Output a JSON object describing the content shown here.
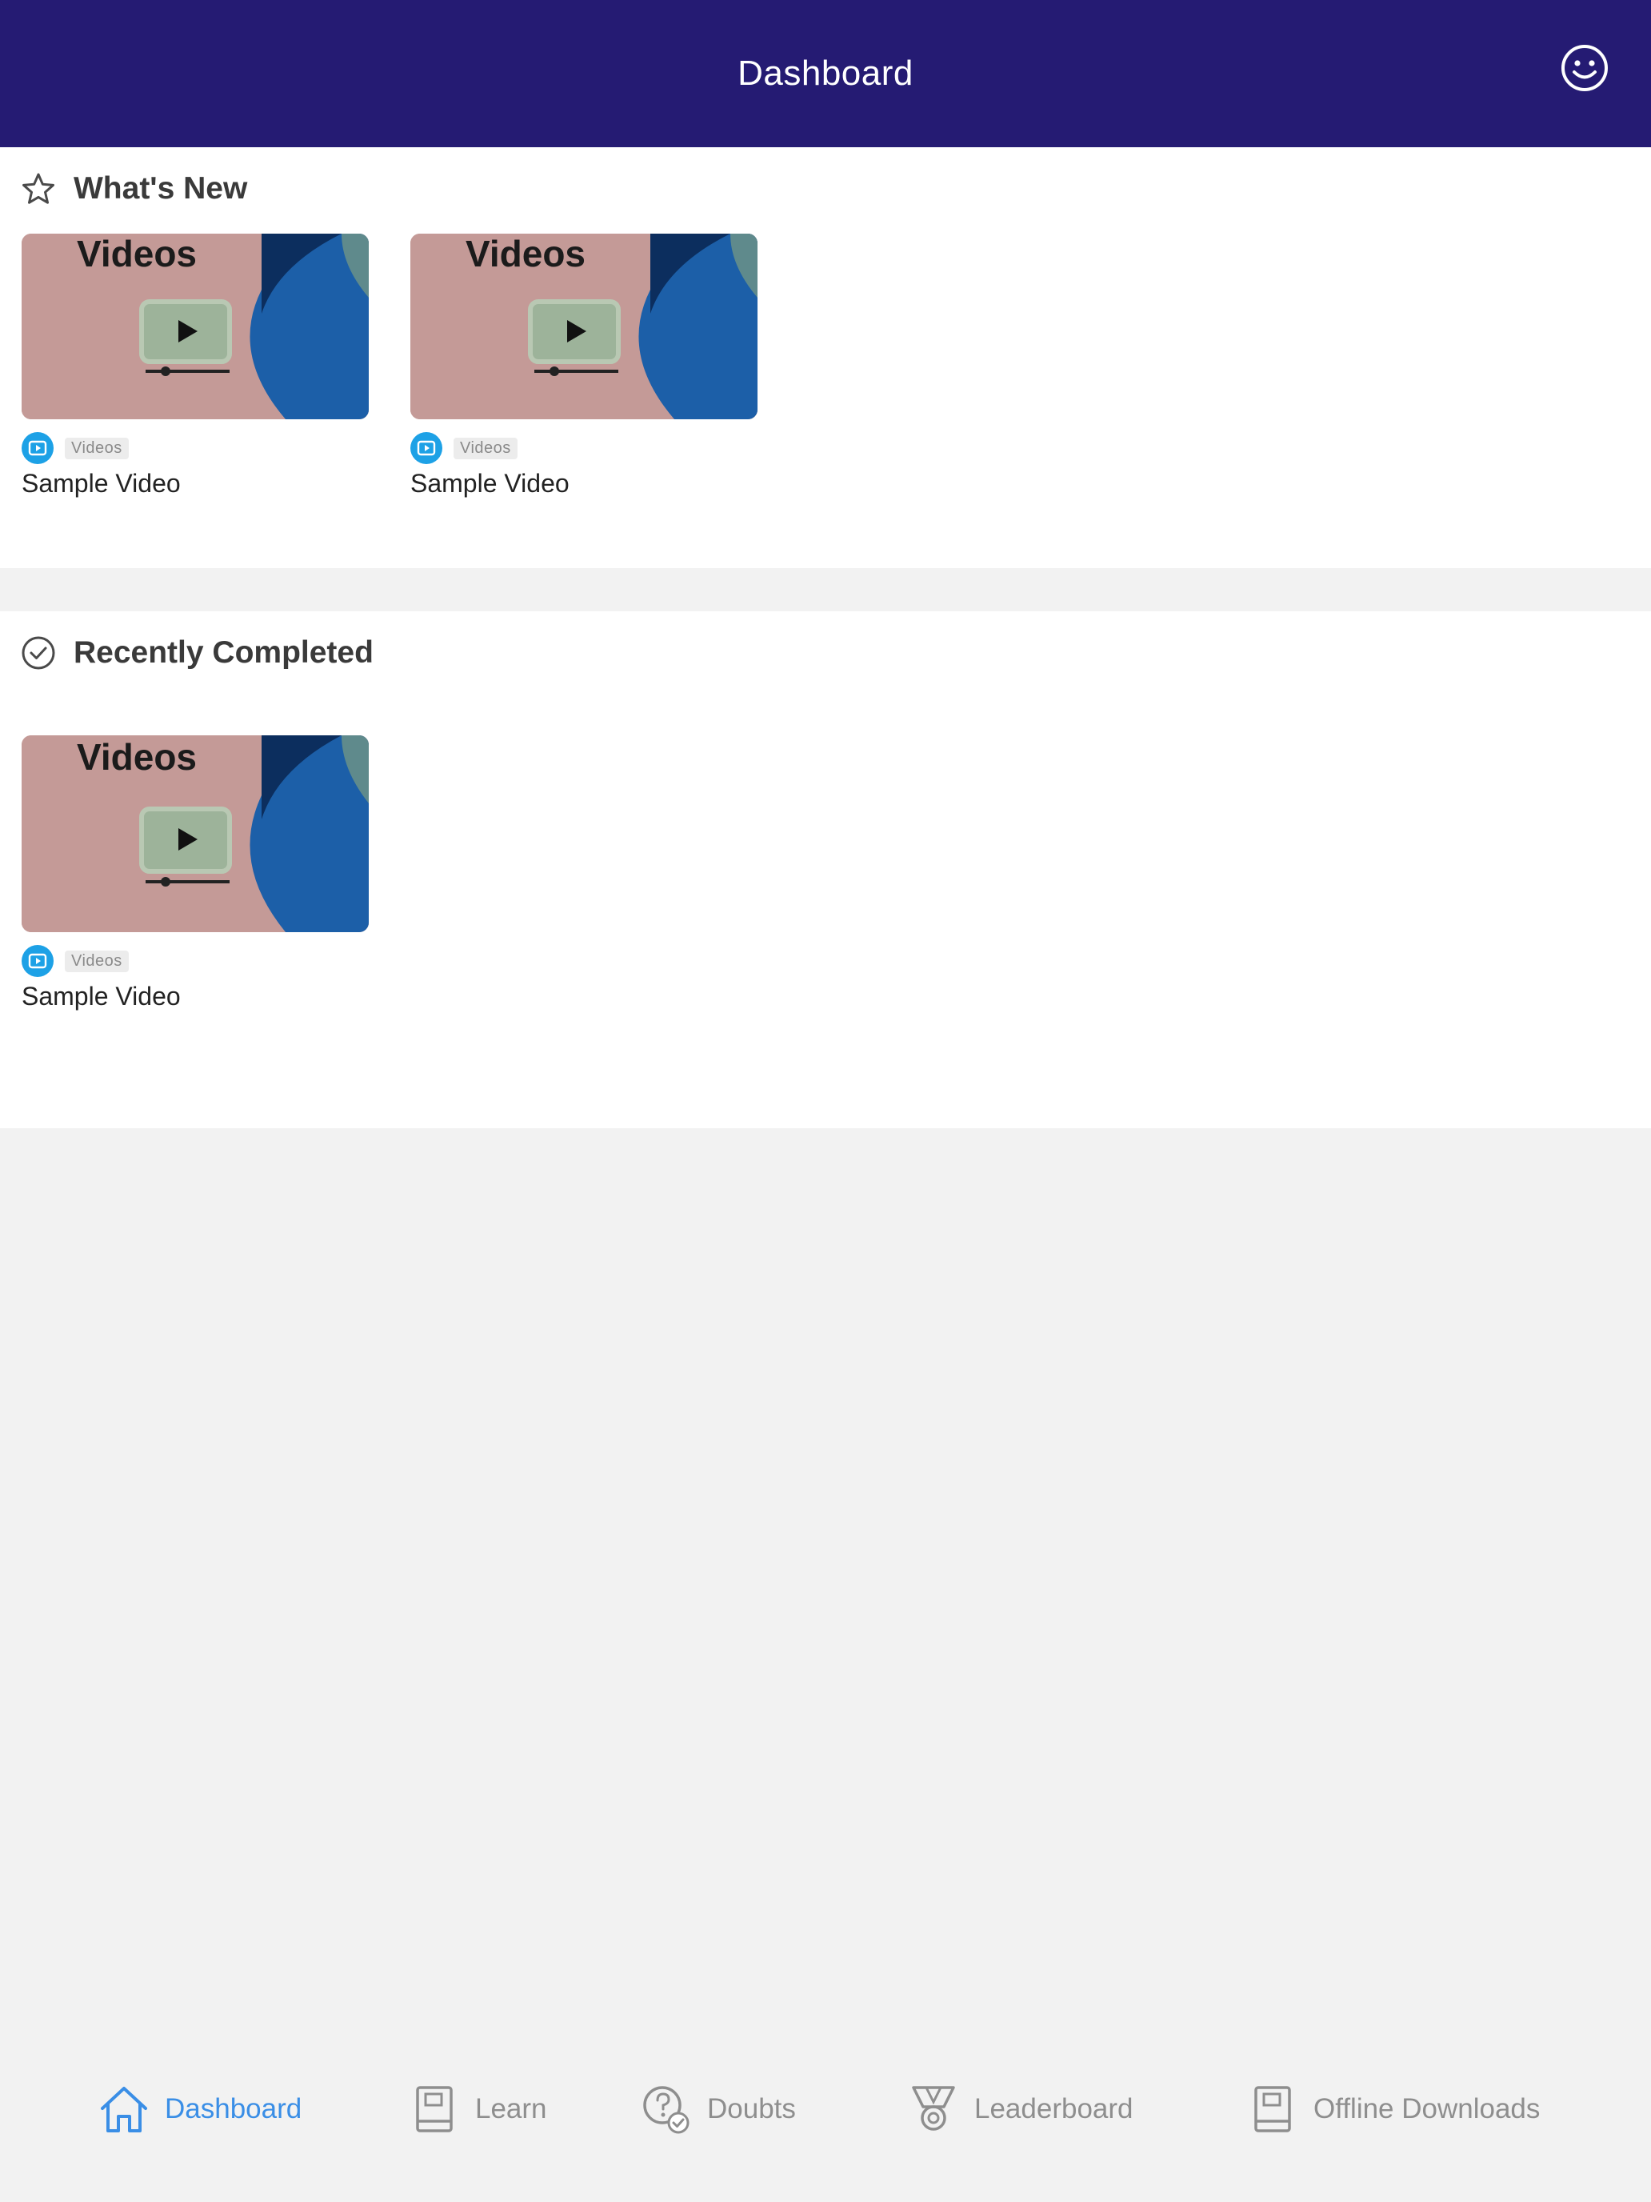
{
  "header": {
    "title": "Dashboard",
    "profile_icon": "smiley-face-icon"
  },
  "whats_new": {
    "title": "What's New",
    "icon": "star-icon",
    "items": [
      {
        "thumbnail_text": "Videos",
        "type": "Videos",
        "title": "Sample Video"
      },
      {
        "thumbnail_text": "Videos",
        "type": "Videos",
        "title": "Sample Video"
      }
    ]
  },
  "recently_completed": {
    "title": "Recently Completed",
    "icon": "check-circle-icon",
    "items": [
      {
        "thumbnail_text": "Videos",
        "type": "Videos",
        "title": "Sample Video"
      }
    ]
  },
  "tabs": [
    {
      "label": "Dashboard",
      "icon": "home-icon",
      "active": true
    },
    {
      "label": "Learn",
      "icon": "book-icon",
      "active": false
    },
    {
      "label": "Doubts",
      "icon": "question-check-icon",
      "active": false
    },
    {
      "label": "Leaderboard",
      "icon": "medal-icon",
      "active": false
    },
    {
      "label": "Offline Downloads",
      "icon": "book-icon",
      "active": false
    }
  ],
  "colors": {
    "header_bg": "#251b73",
    "active_tab": "#3a8ee6",
    "inactive_tab": "#8e8e8e",
    "video_badge": "#1da1e6"
  }
}
